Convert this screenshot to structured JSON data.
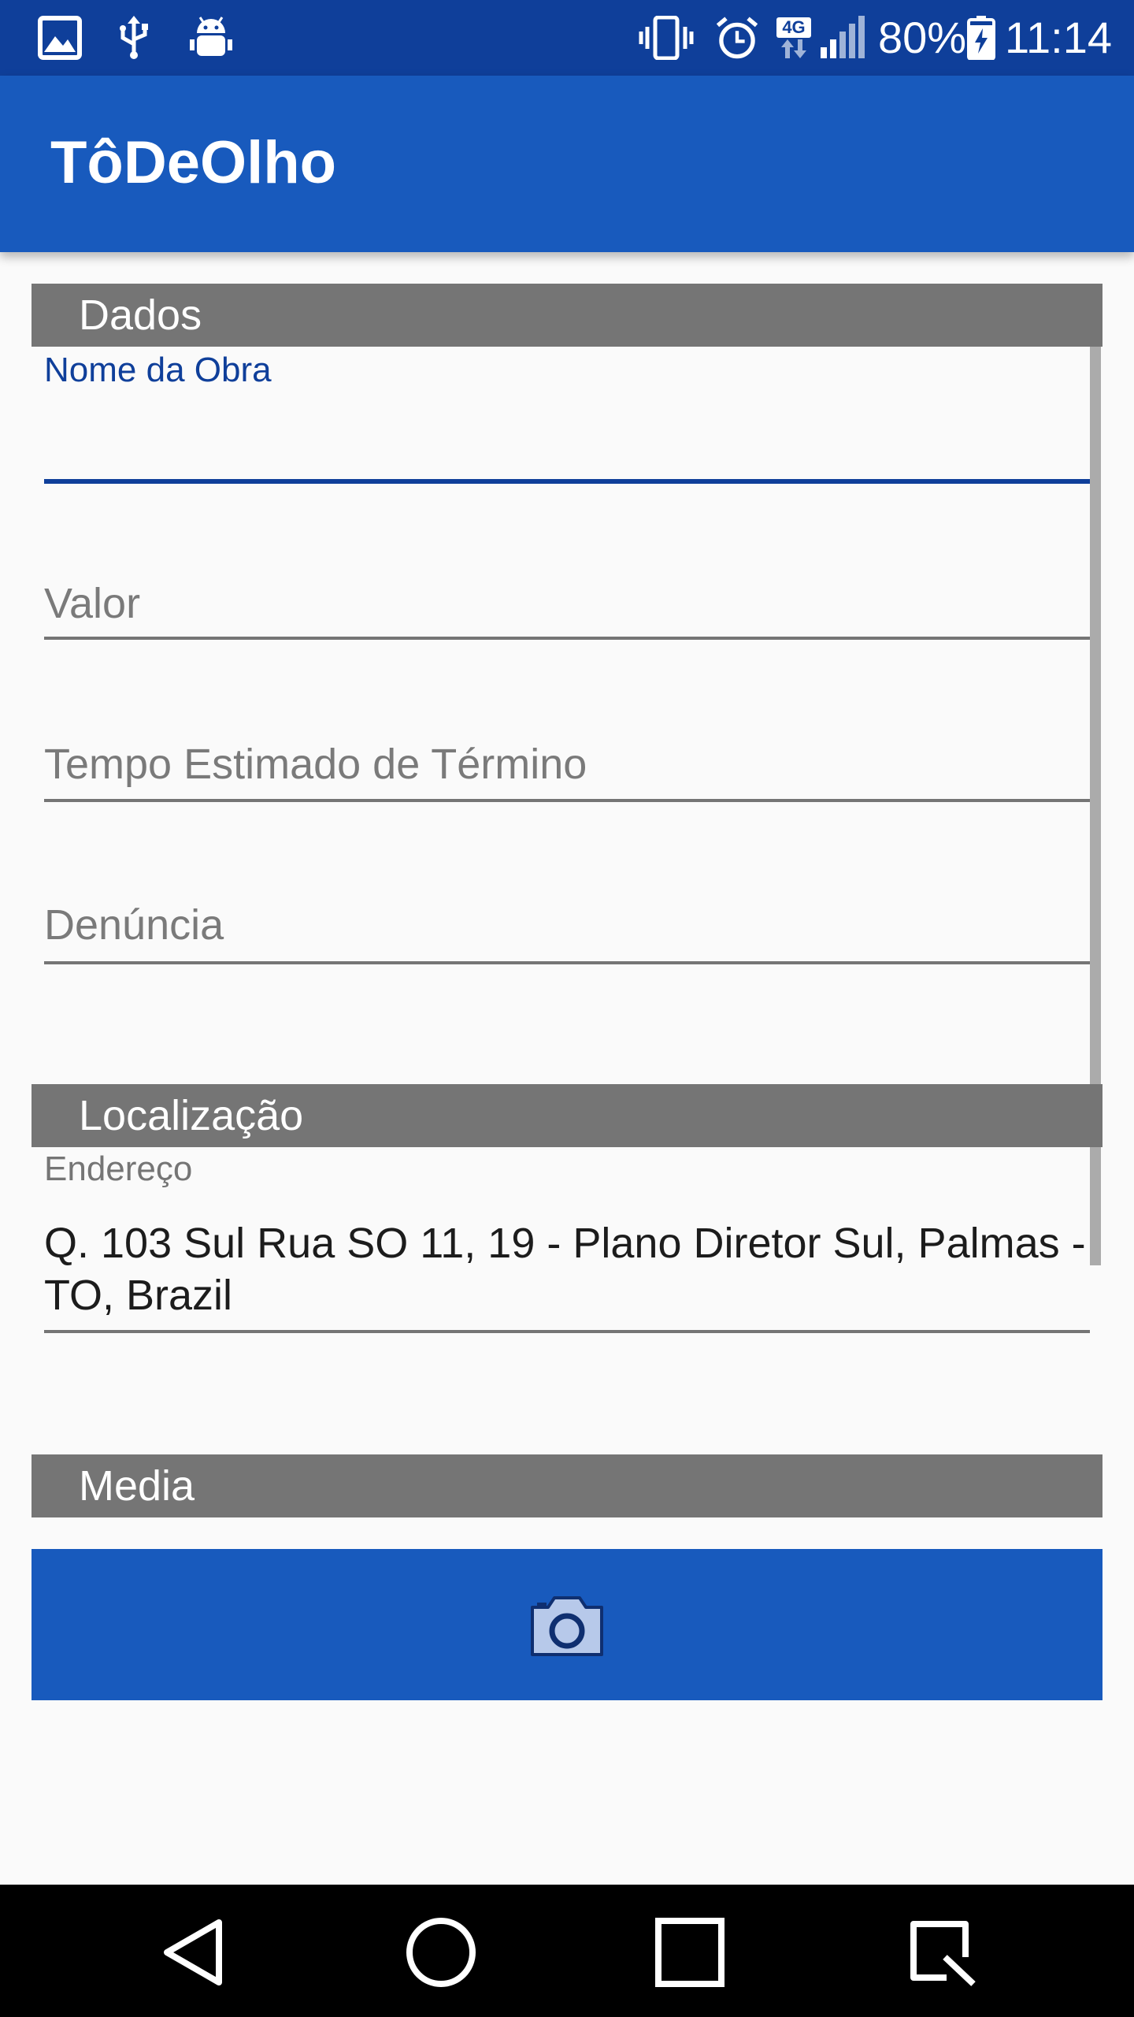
{
  "status_bar": {
    "battery_percent": "80%",
    "time": "11:14",
    "network_type": "4G",
    "icons": [
      "gallery-icon",
      "usb-icon",
      "android-debug-icon",
      "vibrate-icon",
      "alarm-icon",
      "network-4g-icon",
      "signal-icon",
      "battery-charging-icon"
    ]
  },
  "app_bar": {
    "title": "TôDeOlho"
  },
  "sections": {
    "dados": {
      "title": "Dados",
      "fields": {
        "nome_da_obra": {
          "label": "Nome da Obra",
          "value": ""
        },
        "valor": {
          "placeholder": "Valor",
          "value": ""
        },
        "tempo": {
          "placeholder": "Tempo Estimado de Término",
          "value": ""
        },
        "denuncia": {
          "placeholder": "Denúncia",
          "value": ""
        }
      }
    },
    "localizacao": {
      "title": "Localização",
      "endereco_label": "Endereço",
      "endereco_value": "Q. 103 Sul Rua SO 11, 19 - Plano Diretor Sul, Palmas - TO, Brazil"
    },
    "media": {
      "title": "Media",
      "camera_icon": "camera-icon"
    }
  },
  "nav_bar": {
    "icons": [
      "back-icon",
      "home-icon",
      "recents-icon",
      "screen-capture-icon"
    ]
  },
  "colors": {
    "status_bar": "#0f3f9a",
    "primary": "#185abd",
    "section_header": "#757575",
    "focused_accent": "#0f3f9a",
    "background": "#fafafa"
  }
}
